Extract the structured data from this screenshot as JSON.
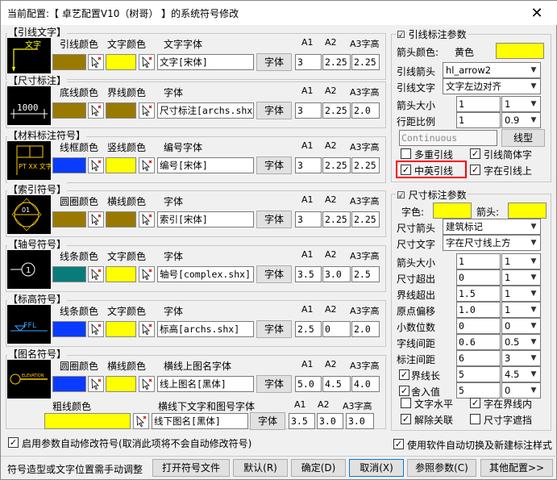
{
  "window": {
    "title": "当前配置:【 卓艺配置V10（树哥） 】的系统符号修改",
    "close": "✕"
  },
  "colors": {
    "yellow": "#ffff00",
    "brown": "#9a7900",
    "blue": "#0a3cff",
    "teal": "#0a7b7b",
    "highlight": "#ff0000"
  },
  "groups": [
    {
      "title": "【引线文字】",
      "preview": "文字",
      "h1": "引线颜色",
      "h2": "文字颜色",
      "h3": "文字字体",
      "font": "文字[宋体]",
      "a1": "3",
      "a2": "2.25",
      "a3": "2.25"
    },
    {
      "title": "【尺寸标注】",
      "preview": "1000",
      "h1": "底线颜色",
      "h2": "界线颜色",
      "h3": "字体",
      "font": "尺寸标注[archs.shx]",
      "a1": "3",
      "a2": "2.25",
      "a3": "2.0"
    },
    {
      "title": "【材料标注符号】",
      "preview": "PT XX 文字",
      "h1": "线框颜色",
      "h2": "竖线颜色",
      "h3": "编号字体",
      "font": "编号[宋体]",
      "a1": "3",
      "a2": "2.25",
      "a3": "2.25"
    },
    {
      "title": "【索引符号】",
      "preview": "01",
      "h1": "圆圈颜色",
      "h2": "横线颜色",
      "h3": "字体",
      "font": "索引[宋体]",
      "a1": "3",
      "a2": "2.25",
      "a3": "2.25"
    },
    {
      "title": "【轴号符号】",
      "preview": "1",
      "h1": "线条颜色",
      "h2": "文字颜色",
      "h3": "字体",
      "font": "轴号[complex.shx]",
      "a1": "3.5",
      "a2": "3.0",
      "a3": "2.5"
    },
    {
      "title": "【标高符号】",
      "preview": "FFL",
      "h1": "线条颜色",
      "h2": "文字颜色",
      "h3": "字体",
      "font": "标高[archs.shx]",
      "a1": "2.5",
      "a2": "0",
      "a3": "2.0"
    },
    {
      "title": "【图名符号】",
      "preview": "ELEVATION",
      "h1": "圆圈颜色",
      "h2": "横线颜色",
      "h3": "横线上图名字体",
      "font": "线上图名[黑体]",
      "a1": "5.0",
      "a2": "4.5",
      "a3": "4.0",
      "h4": "粗线颜色",
      "h5": "横线下文字和图号字体",
      "font2": "线下图名[黑体]",
      "b1": "3.5",
      "b2": "3.0",
      "b3": "3.0"
    }
  ],
  "cols": {
    "a1": "A1",
    "a2": "A2",
    "a3": "A3字高",
    "font_btn": "字体"
  },
  "leader": {
    "title": "引线标注参数",
    "arrow_color_label": "箭头颜色:",
    "arrow_color_name": "黄色",
    "arrow_label": "引线箭头",
    "arrow_value": "hl_arrow2",
    "text_label": "引线文字",
    "text_value": "文字左边对齐",
    "size_label": "箭头大小",
    "size_value": "1",
    "size_combo": "1",
    "scale_label": "行距比例",
    "scale_value": "1",
    "scale_combo": "0.9",
    "linetype_value": "Continuous",
    "linetype_btn": "线型",
    "cb1": "多重引线",
    "cb2": "引线简体字",
    "cb3": "中英引线",
    "cb4": "字在引线上"
  },
  "dim": {
    "title": "尺寸标注参数",
    "text_color_label": "字色:",
    "arrow_label": "箭头:",
    "arrow_type_label": "尺寸箭头",
    "arrow_type_value": "建筑标记",
    "dim_text_label": "尺寸文字",
    "dim_text_value": "字在尺寸线上方",
    "rows": [
      {
        "label": "箭头大小",
        "value": "1",
        "combo": "1"
      },
      {
        "label": "尺寸超出",
        "value": "0",
        "combo": "1"
      },
      {
        "label": "界线超出",
        "value": "1.5",
        "combo": "1"
      },
      {
        "label": "原点偏移",
        "value": "1.0",
        "combo": "1"
      },
      {
        "label": "小数位数",
        "value": "0",
        "combo": "0"
      },
      {
        "label": "字线间距",
        "value": "0.6",
        "combo": "0.5"
      },
      {
        "label": "标注间距",
        "value": "6",
        "combo": "3"
      },
      {
        "label": "界线长",
        "value": "5",
        "combo": "4.5"
      },
      {
        "label": "舍入值",
        "value": "5",
        "combo": "0"
      }
    ],
    "cb_a": "文字水平",
    "cb_b": "字在界线内",
    "cb_c": "解除关联",
    "cb_d": "尺寸字遮挡"
  },
  "bottom": {
    "auto_modify": "启用参数自动修改符号(取消此项将不会自动修改符号)",
    "auto_switch": "使用软件自动切换及新建标注样式",
    "hint": "符号造型或文字位置需手动调整",
    "btn_open": "打开符号文件",
    "btn_default": "默认(R)",
    "btn_ok": "确定(D)",
    "btn_cancel": "取消(X)",
    "btn_ref": "参照参数(C)",
    "btn_more": "其他配置>>"
  }
}
